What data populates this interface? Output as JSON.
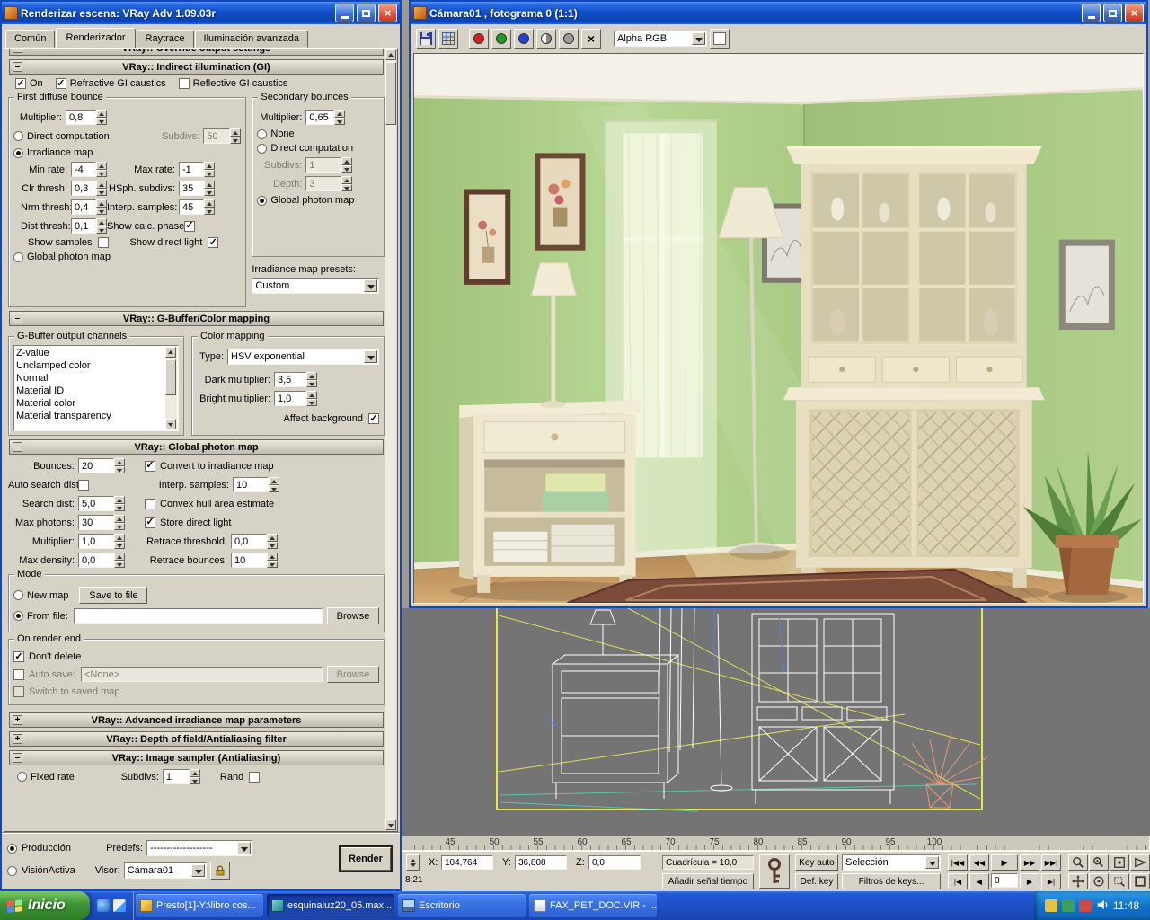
{
  "icons": {
    "close": "×",
    "minus": "–",
    "plus": "+"
  },
  "render_dialog": {
    "title": "Renderizar escena: VRay Adv 1.09.03r",
    "tabs": [
      "Común",
      "Renderizador",
      "Raytrace",
      "Iluminación avanzada"
    ],
    "rollouts": {
      "override": "VRay:: Override output settings",
      "gi": "VRay:: Indirect illumination (GI)",
      "gbuffer": "VRay:: G-Buffer/Color mapping",
      "photon": "VRay:: Global photon map",
      "advanced": "VRay:: Advanced irradiance map parameters",
      "dof": "VRay:: Depth of field/Antialiasing filter",
      "sampler": "VRay:: Image sampler (Antialiasing)"
    },
    "gi": {
      "on_label": "On",
      "refractive_label": "Refractive GI caustics",
      "reflective_label": "Reflective GI caustics",
      "first": {
        "group_title": "First diffuse bounce",
        "multiplier_label": "Multiplier:",
        "multiplier_value": "0,8",
        "direct_label": "Direct computation",
        "subdivs_label": "Subdivs:",
        "subdivs_value": "50",
        "irradiance_label": "Irradiance map",
        "min_rate_label": "Min rate:",
        "min_rate_value": "-4",
        "max_rate_label": "Max rate:",
        "max_rate_value": "-1",
        "clr_label": "Clr thresh:",
        "clr_value": "0,3",
        "hsph_label": "HSph. subdivs:",
        "hsph_value": "35",
        "nrm_label": "Nrm thresh:",
        "nrm_value": "0,4",
        "interp_label": "Interp. samples:",
        "interp_value": "45",
        "dist_label": "Dist thresh:",
        "dist_value": "0,1",
        "show_calc_label": "Show calc. phase",
        "show_samples_label": "Show samples",
        "show_direct_label": "Show direct light",
        "photon_label": "Global photon map"
      },
      "secondary": {
        "group_title": "Secondary bounces",
        "multiplier_label": "Multiplier:",
        "multiplier_value": "0,65",
        "none_label": "None",
        "direct_label": "Direct computation",
        "subdivs_label": "Subdivs:",
        "subdivs_value": "1",
        "depth_label": "Depth:",
        "depth_value": "3",
        "photon_label": "Global photon map"
      },
      "presets_label": "Irradiance map presets:",
      "presets_value": "Custom"
    },
    "gbuffer": {
      "channels_title": "G-Buffer output channels",
      "channels": [
        "Z-value",
        "Unclamped color",
        "Normal",
        "Material ID",
        "Material color",
        "Material transparency"
      ],
      "mapping_title": "Color mapping",
      "type_label": "Type:",
      "type_value": "HSV exponential",
      "dark_label": "Dark multiplier:",
      "dark_value": "3,5",
      "bright_label": "Bright multiplier:",
      "bright_value": "1,0",
      "affect_label": "Affect background"
    },
    "photon": {
      "bounces_label": "Bounces:",
      "bounces_value": "20",
      "auto_label": "Auto search dist",
      "search_label": "Search dist:",
      "search_value": "5,0",
      "maxphotons_label": "Max photons:",
      "maxphotons_value": "30",
      "multiplier_label": "Multiplier:",
      "multiplier_value": "1,0",
      "maxdensity_label": "Max density:",
      "maxdensity_value": "0,0",
      "convert_label": "Convert to irradiance map",
      "interp_label": "Interp. samples:",
      "interp_value": "10",
      "convex_label": "Convex hull area estimate",
      "store_label": "Store direct light",
      "retrace_label": "Retrace threshold:",
      "retrace_value": "0,0",
      "retrace_bounces_label": "Retrace bounces:",
      "retrace_bounces_value": "10",
      "mode_title": "Mode",
      "new_map_label": "New map",
      "save_file_btn": "Save to file",
      "from_file_label": "From file:",
      "from_file_value": "",
      "browse_btn": "Browse",
      "end_title": "On render end",
      "dont_delete_label": "Don't delete",
      "autosave_label": "Auto save:",
      "autosave_value": "<None>",
      "browse2_btn": "Browse",
      "switch_label": "Switch to saved map"
    },
    "sampler": {
      "fixed_label": "Fixed rate",
      "subdivs_label": "Subdivs:",
      "subdivs_value": "1",
      "rand_label": "Rand"
    },
    "footer": {
      "production_label": "Producción",
      "activeshade_label": "VisiónActiva",
      "presets_label": "Predefs:",
      "presets_value": "-------------------",
      "viewport_label": "Visor:",
      "viewport_value": "Cámara01",
      "render_btn": "Render"
    }
  },
  "vfb": {
    "title": "Cámara01 , fotograma 0 (1:1)",
    "channel_value": "Alpha RGB"
  },
  "timeline": {
    "ticks": [
      "45",
      "50",
      "55",
      "60",
      "65",
      "70",
      "75",
      "80",
      "85",
      "90",
      "95",
      "100"
    ]
  },
  "statusbar": {
    "prompt": "8:21",
    "x_label": "X:",
    "x_value": "104,764",
    "y_label": "Y:",
    "y_value": "36,808",
    "z_label": "Z:",
    "z_value": "0,0",
    "grid_label": "Cuadrícula = 10,0",
    "add_time": "Añadir señal tiempo",
    "key_auto": "Key auto",
    "selection": "Selección",
    "def_key": "Def. key",
    "key_filters": "Filtros de keys...",
    "frame_value": "0"
  },
  "transport": {
    "go_start": "|◀◀",
    "prev": "◀◀",
    "play": "▶",
    "next": "▶▶",
    "go_end": "▶▶|",
    "prev_key": "|◀",
    "back": "◀",
    "fwd": "▶",
    "next_key": "▶|"
  },
  "taskbar": {
    "start_label": "Inicio",
    "tasks": [
      {
        "label": "Presto[1]-Y:\\libro cos..."
      },
      {
        "label": "esquinaluz20_05.max..."
      },
      {
        "label": "Escritorio"
      },
      {
        "label": "FAX_PET_DOC.VIR - ..."
      }
    ],
    "clock": "11:48"
  }
}
